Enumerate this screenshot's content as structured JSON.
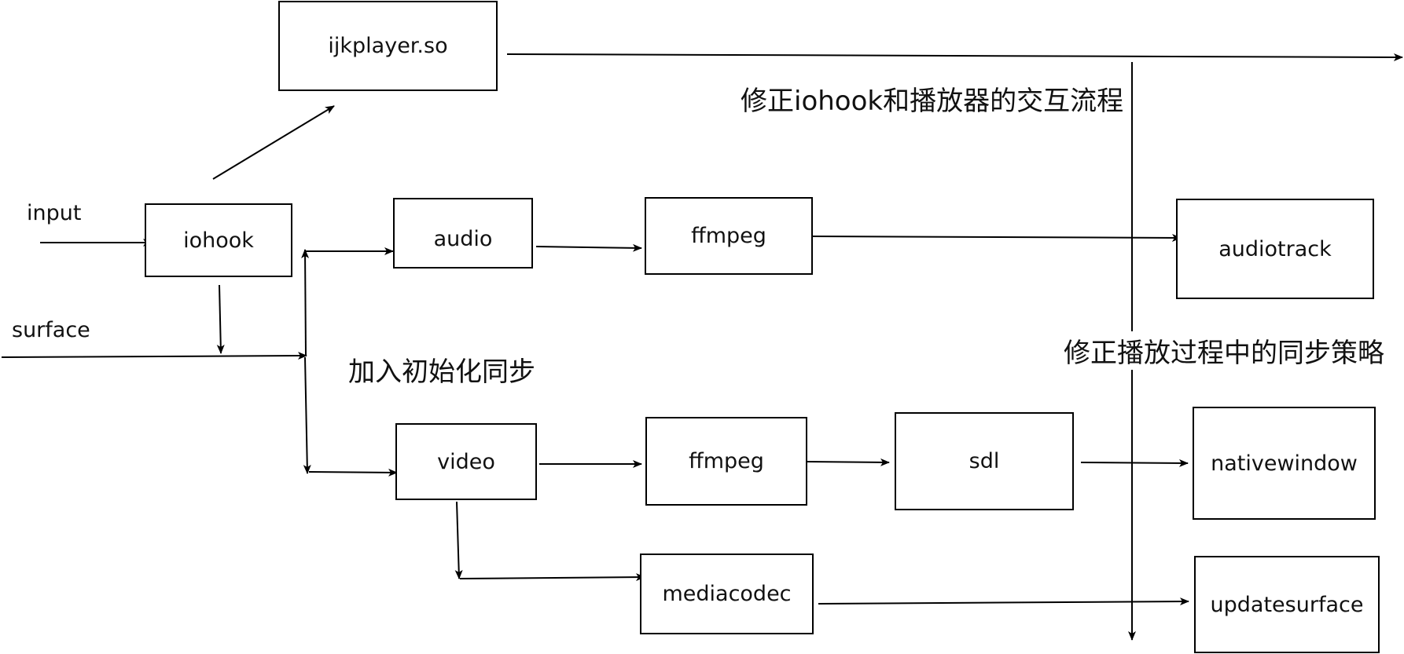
{
  "nodes": {
    "ijkplayer": "ijkplayer.so",
    "iohook": "iohook",
    "audio": "audio",
    "ffmpeg_audio": "ffmpeg",
    "audiotrack": "audiotrack",
    "video": "video",
    "ffmpeg_video": "ffmpeg",
    "sdl": "sdl",
    "nativewindow": "nativewindow",
    "mediacodec": "mediacodec",
    "updatesurface": "updatesurface"
  },
  "labels": {
    "input": "input",
    "surface": "surface",
    "init_sync": "加入初始化同步",
    "fix_interaction": "修正iohook和播放器的交互流程",
    "fix_sync_policy": "修正播放过程中的同步策略"
  },
  "colors": {
    "stroke": "#000000",
    "text": "#111111",
    "background": "#ffffff"
  }
}
